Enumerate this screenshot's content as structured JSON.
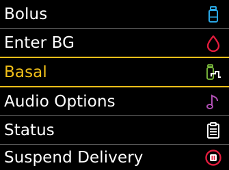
{
  "menu": {
    "items": [
      {
        "label": "Bolus",
        "icon": "vial-icon",
        "color": "#2aa8e6",
        "selected": false
      },
      {
        "label": "Enter BG",
        "icon": "blood-drop-icon",
        "color": "#e31c3d",
        "selected": false
      },
      {
        "label": "Basal",
        "icon": "basal-program-icon",
        "color": "#7fc03f",
        "selected": true
      },
      {
        "label": "Audio Options",
        "icon": "music-note-icon",
        "color": "#b04fb4",
        "selected": false
      },
      {
        "label": "Status",
        "icon": "clipboard-icon",
        "color": "#ffffff",
        "selected": false
      },
      {
        "label": "Suspend Delivery",
        "icon": "pause-stop-icon",
        "color": "#e31c3d",
        "selected": false
      }
    ],
    "selection_color": "#f2c019",
    "divider_color": "#5a5a5a"
  }
}
